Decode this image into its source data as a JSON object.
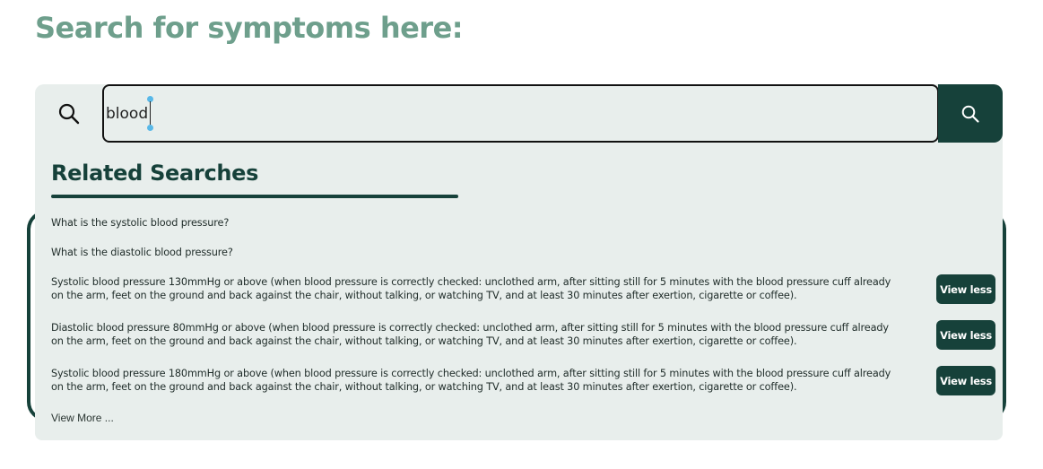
{
  "page": {
    "title": "Search for symptoms here:"
  },
  "search": {
    "value": "blood",
    "search_icon": "search-icon",
    "submit_icon": "search-icon"
  },
  "dropdown": {
    "heading": "Related Searches",
    "results": [
      {
        "text": "What is the systolic blood pressure?"
      },
      {
        "text": "What is the diastolic blood pressure?"
      },
      {
        "text": "Systolic blood pressure 130mmHg or above (when blood pressure is correctly checked: unclothed arm, after sitting still for 5 minutes with the blood pressure cuff already on the arm, feet on the ground and back against the chair, without talking, or watching TV, and at least 30 minutes after exertion, cigarette or coffee).",
        "button": "View less"
      },
      {
        "text": "Diastolic blood pressure 80mmHg or above (when blood pressure is correctly checked: unclothed arm, after sitting still for 5 minutes with the blood pressure cuff already on the arm, feet on the ground and back against the chair, without talking, or watching TV, and at least 30 minutes after exertion, cigarette or coffee).",
        "button": "View less"
      },
      {
        "text": "Systolic blood pressure 180mmHg or above (when blood pressure is correctly checked: unclothed arm, after sitting still for 5 minutes with the blood pressure cuff already on the arm, feet on the ground and back against the chair, without talking, or watching TV, and at least 30 minutes after exertion, cigarette or coffee).",
        "button": "View less"
      }
    ],
    "view_more": "View More ..."
  },
  "colors": {
    "title": "#6e9f8c",
    "accent_dark": "#16413a",
    "panel_bg": "#e8eeec"
  }
}
